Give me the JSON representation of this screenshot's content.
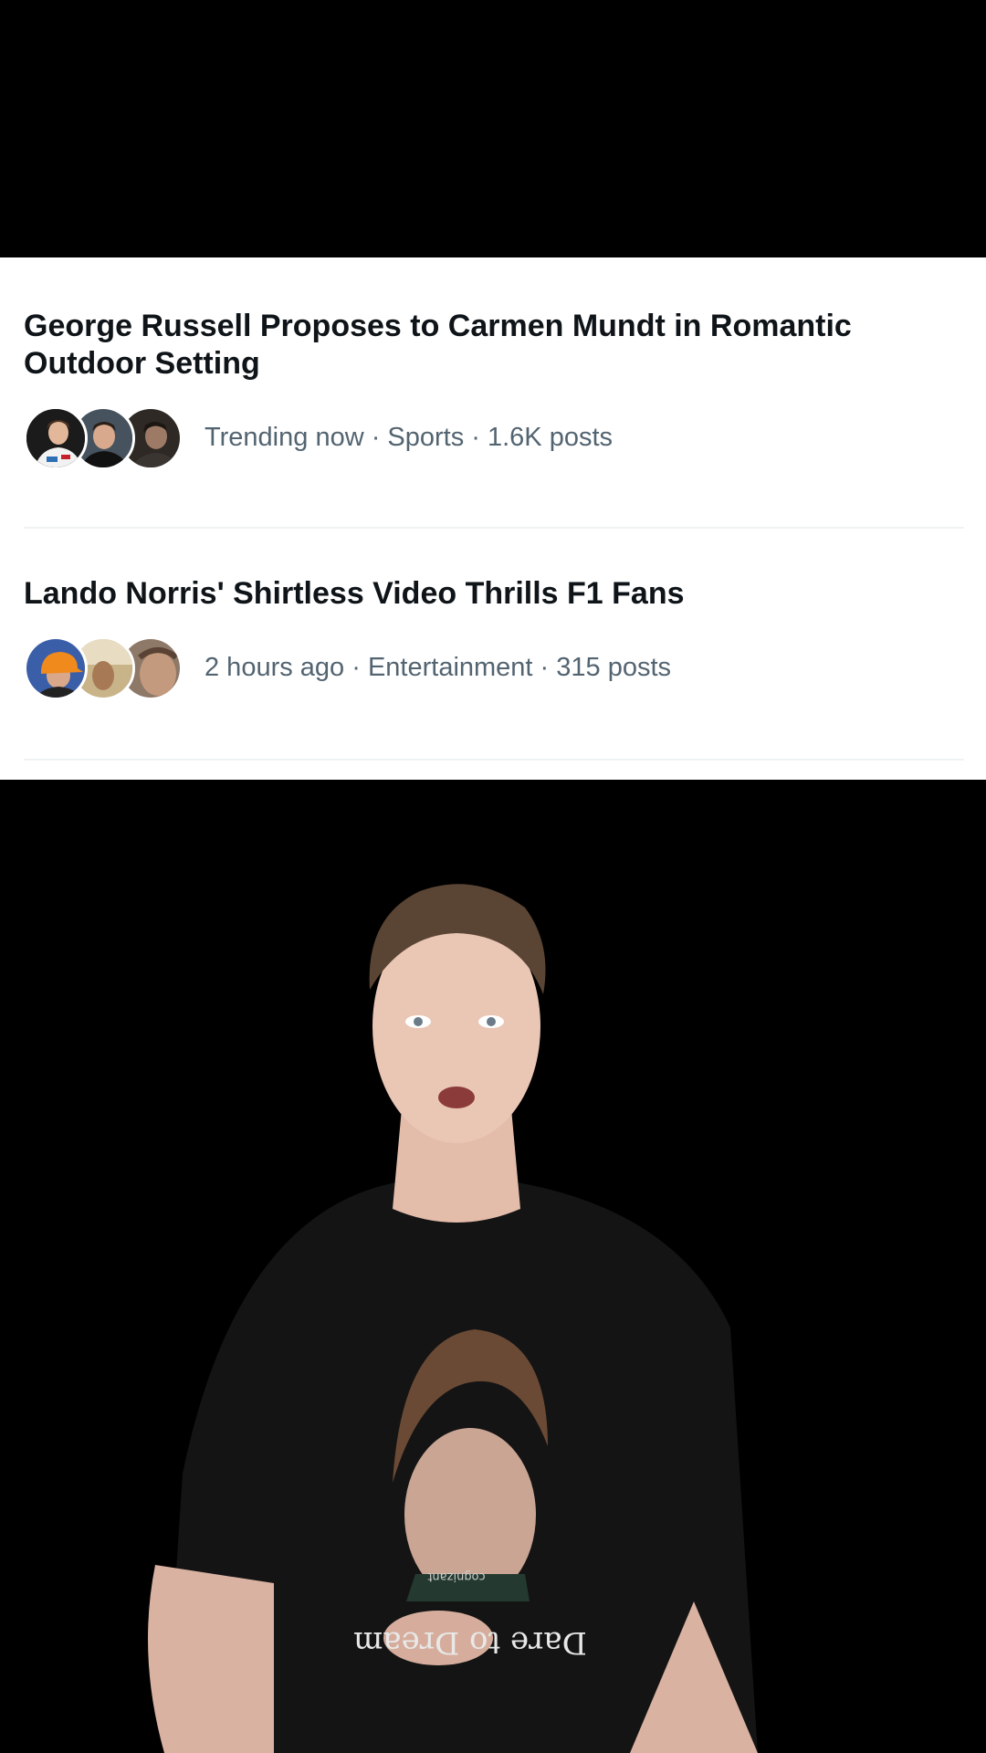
{
  "trends": [
    {
      "title": "George Russell Proposes to Carmen Mundt in Romantic Outdoor Setting",
      "meta": "Trending now · Sports · 1.6K posts",
      "avatar_icons": [
        "racer-avatar-icon",
        "driver-avatar-icon",
        "person-avatar-icon"
      ]
    },
    {
      "title": "Lando Norris' Shirtless Video Thrills F1 Fans",
      "meta": "2 hours ago · Entertainment · 315 posts",
      "avatar_icons": [
        "orange-cap-avatar-icon",
        "beach-avatar-icon",
        "shirtless-avatar-icon"
      ]
    }
  ],
  "video": {
    "shirt_text": "Dare to Dream",
    "shirt_brand": "cognizant"
  },
  "colors": {
    "title": "#0f1419",
    "meta": "#536471",
    "divider": "#eff3f4",
    "background": "#000000"
  }
}
